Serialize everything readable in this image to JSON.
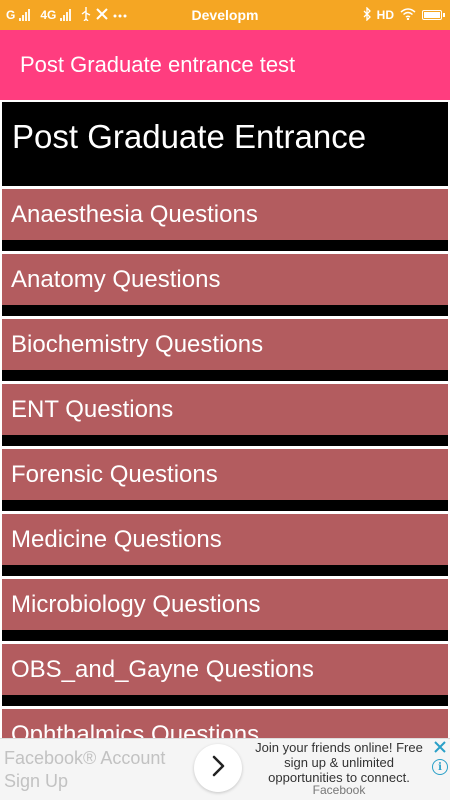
{
  "status_bar": {
    "left_label": "G",
    "network_label": "4G",
    "title": "Developm",
    "right_label": "HD"
  },
  "app_bar": {
    "title": "Post Graduate entrance test"
  },
  "header": {
    "title": "Post Graduate Entrance"
  },
  "list": {
    "items": [
      "Anaesthesia Questions",
      "Anatomy Questions",
      "Biochemistry Questions",
      "ENT Questions",
      "Forensic Questions",
      "Medicine Questions",
      "Microbiology Questions",
      "OBS_and_Gayne Questions",
      "Ophthalmics Questions"
    ]
  },
  "ad": {
    "title": "Facebook® Account Sign Up",
    "description": "Join your friends online! Free sign up & unlimited opportunities to connect.",
    "source": "Facebook",
    "info_label": "i"
  },
  "colors": {
    "status_bar": "#f5a623",
    "app_bar": "#ff3d7f",
    "list_item": "#b35c5f",
    "header_block": "#000000"
  },
  "icons": [
    "signal-icon",
    "usb-icon",
    "tools-icon",
    "more-icon",
    "bluetooth-icon",
    "wifi-icon",
    "battery-icon",
    "chevron-right-icon",
    "close-icon",
    "info-icon"
  ]
}
